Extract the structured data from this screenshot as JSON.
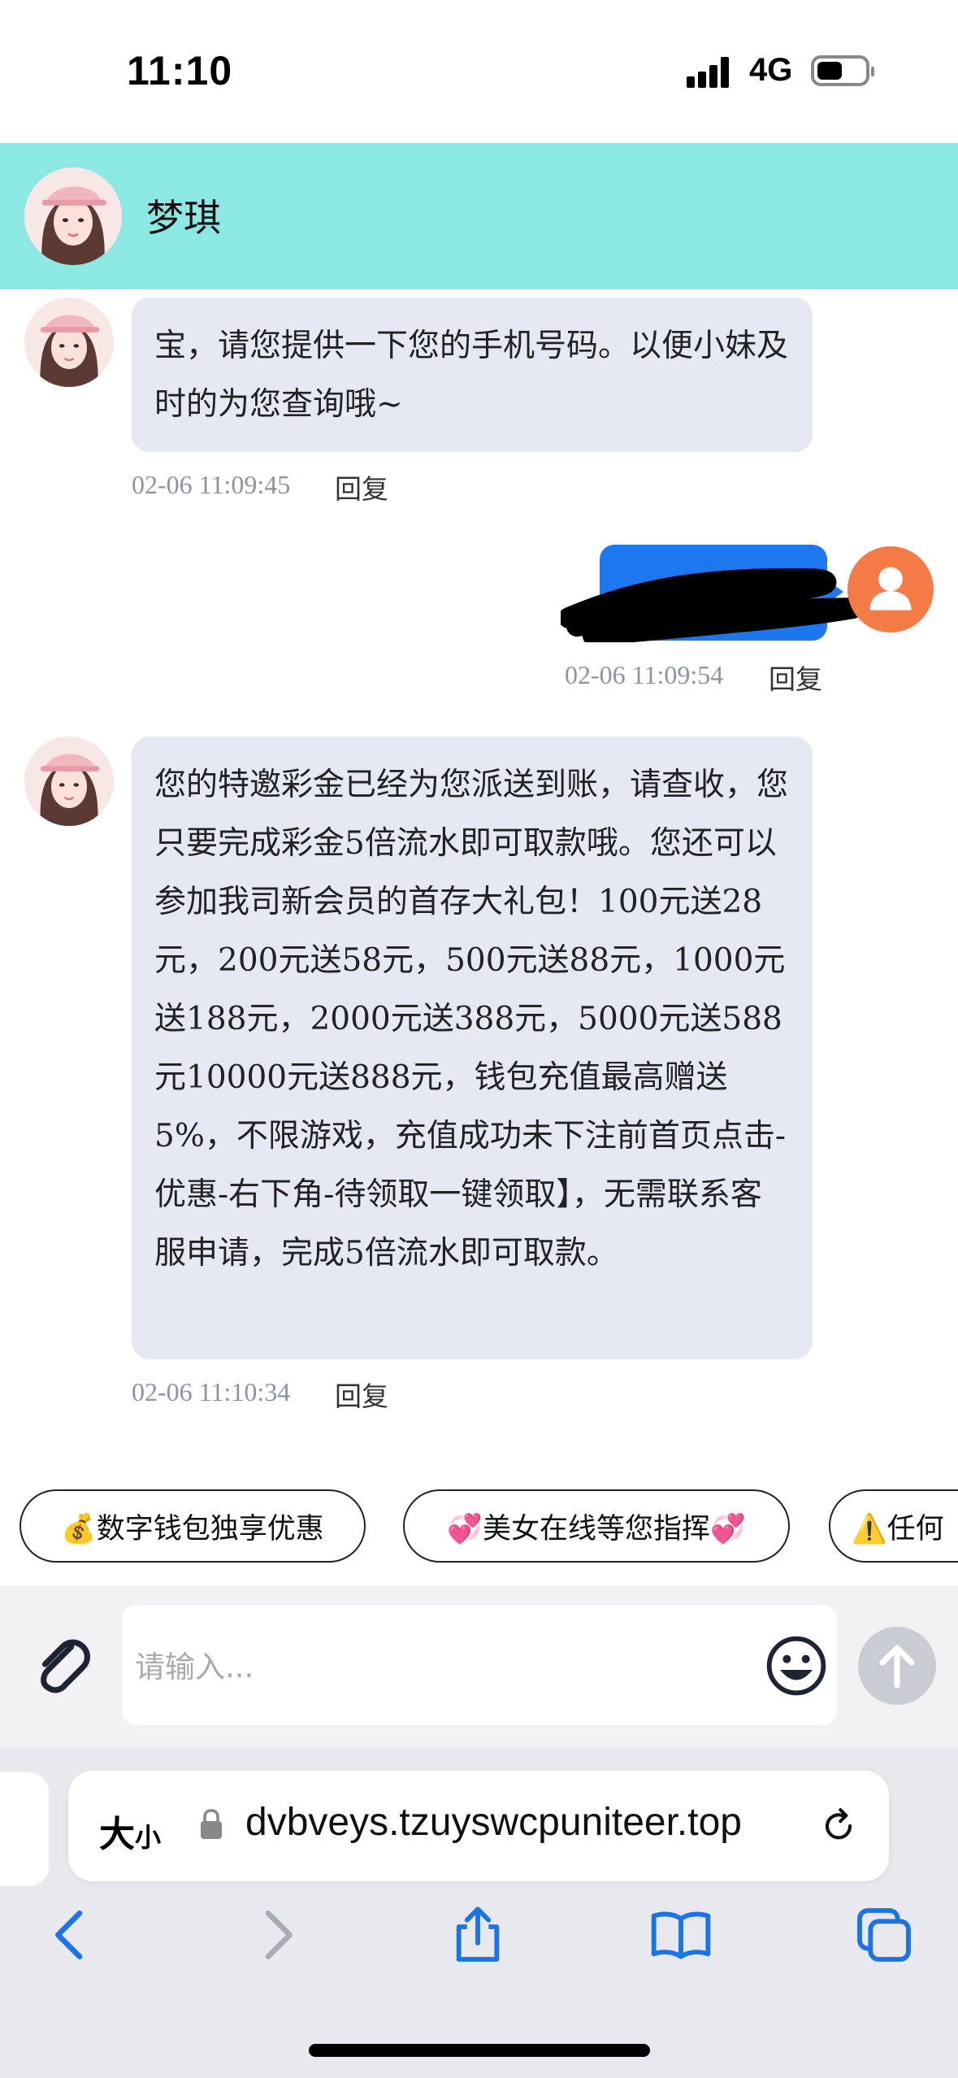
{
  "status_bar": {
    "time": "11:10",
    "network": "4G"
  },
  "chat": {
    "contact_name": "梦琪",
    "messages": [
      {
        "direction": "incoming",
        "text": "宝，请您提供一下您的手机号码。以便小妹及时的为您查询哦~",
        "timestamp": "02-06 11:09:45",
        "reply_label": "回复"
      },
      {
        "direction": "outgoing",
        "text": "[redacted]",
        "timestamp": "02-06 11:09:54",
        "reply_label": "回复"
      },
      {
        "direction": "incoming",
        "text": "您的特邀彩金已经为您派送到账，请查收，您只要完成彩金5倍流水即可取款哦。您还可以参加我司新会员的首存大礼包！100元送28元，200元送58元，500元送88元，1000元送188元，2000元送388元，5000元送588元10000元送888元，钱包充值最高赠送5%，不限游戏，充值成功未下注前首页点击-优惠-右下角-待领取一键领取】，无需联系客服申请，完成5倍流水即可取款。",
        "timestamp": "02-06 11:10:34",
        "reply_label": "回复"
      }
    ]
  },
  "quick_replies": [
    "💰数字钱包独享优惠",
    "💞美女在线等您指挥💞",
    "⚠️任何"
  ],
  "composer": {
    "placeholder": "请输入..."
  },
  "browser": {
    "text_size_label": "大",
    "text_size_small": "小",
    "url": "dvbveys.tzuyswcpuniteer.top"
  },
  "icons": {
    "attach": "paperclip-icon",
    "emoji": "smiley-icon",
    "send": "arrow-up-icon",
    "lock": "lock-icon",
    "reload": "reload-icon",
    "back": "back-chevron-icon",
    "forward": "forward-chevron-icon",
    "share": "share-icon",
    "bookmarks": "book-icon",
    "tabs": "tabs-icon"
  },
  "colors": {
    "header_bg": "#8be8e2",
    "incoming_bubble": "#e4e9f3",
    "outgoing_bubble": "#1d78f0",
    "user_avatar": "#f47a46"
  }
}
